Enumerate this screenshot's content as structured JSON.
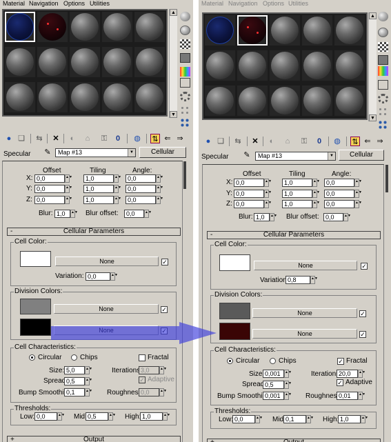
{
  "menu": [
    "Material",
    "Navigation",
    "Options",
    "Utilities"
  ],
  "editor": {
    "map_label": "Specular",
    "map_name": "Map #13",
    "map_type": "Cellular",
    "offset_header": "Offset",
    "tiling_header": "Tiling",
    "angle_header": "Angle:",
    "axes": [
      "X:",
      "Y:",
      "Z:"
    ],
    "offset_values": [
      "0,0",
      "0,0",
      "0,0"
    ],
    "tiling_values": [
      "1,0",
      "1,0",
      "1,0"
    ],
    "angle_values": [
      "0,0",
      "0,0",
      "0,0"
    ],
    "blur_label": "Blur:",
    "blur_value": "1,0",
    "blur_offset_label": "Blur offset:",
    "blur_offset_value": "0,0",
    "rollout_title": "Cellular Parameters",
    "rollout_toggle": "-",
    "cell_color_title": "Cell Color:",
    "none_label": "None",
    "variation_label": "Variation:",
    "division_colors_title": "Division Colors:",
    "cell_char_title": "Cell Characteristics:",
    "circular_label": "Circular",
    "chips_label": "Chips",
    "fractal_label": "Fractal",
    "size_label": "Size:",
    "iterations_label": "Iterations:",
    "adaptive_label": "Adaptive",
    "spread_label": "Spread:",
    "bump_label": "Bump Smoothing:",
    "roughness_label": "Roughness:",
    "thresholds_title": "Thresholds:",
    "low_label": "Low:",
    "mid_label": "Mid:",
    "high_label": "High:",
    "output_label": "Output",
    "output_toggle": "+"
  },
  "before": {
    "variation": "0,0",
    "size": "5,0",
    "iterations": "3,0",
    "spread": "0,5",
    "bump_smoothing": "0,1",
    "roughness": "0,0",
    "low": "0,0",
    "mid": "0,5",
    "high": "1,0",
    "fractal": false,
    "adaptive": true,
    "cell_color": "#ffffff",
    "division_color_1": "#808080",
    "division_color_2": "#000000"
  },
  "after": {
    "variation": "0,8",
    "size": "0,001",
    "iterations": "20,0",
    "spread": "0,5",
    "bump_smoothing": "0,001",
    "roughness": "0,01",
    "low": "0,0",
    "mid": "0,1",
    "high": "1,0",
    "fractal": true,
    "adaptive": true,
    "cell_color": "#ffffff",
    "division_color_1": "#5a5a5a",
    "division_color_2": "#3a0505"
  },
  "colors": {
    "panel_bg": "#d4d0c8",
    "arrow": "#3c3cdc",
    "toolbar_active": "#f3d255"
  }
}
